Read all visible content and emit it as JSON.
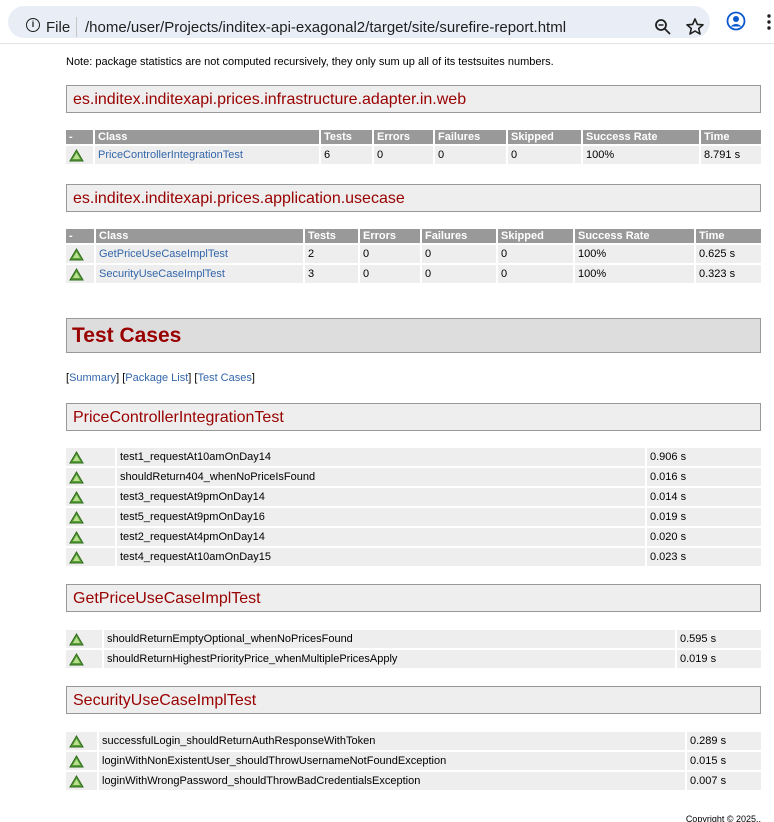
{
  "browser": {
    "scheme_label": "File",
    "url": "/home/user/Projects/inditex-api-exagonal2/target/site/surefire-report.html"
  },
  "note": "Note: package statistics are not computed recursively, they only sum up all of its testsuites numbers.",
  "packages": [
    {
      "name": "es.inditex.inditexapi.prices.infrastructure.adapter.in.web",
      "headers": [
        "-",
        "Class",
        "Tests",
        "Errors",
        "Failures",
        "Skipped",
        "Success Rate",
        "Time"
      ],
      "rows": [
        {
          "class": "PriceControllerIntegrationTest",
          "tests": "6",
          "errors": "0",
          "failures": "0",
          "skipped": "0",
          "success_rate": "100%",
          "time": "8.791 s"
        }
      ]
    },
    {
      "name": "es.inditex.inditexapi.prices.application.usecase",
      "headers": [
        "-",
        "Class",
        "Tests",
        "Errors",
        "Failures",
        "Skipped",
        "Success Rate",
        "Time"
      ],
      "rows": [
        {
          "class": "GetPriceUseCaseImplTest",
          "tests": "2",
          "errors": "0",
          "failures": "0",
          "skipped": "0",
          "success_rate": "100%",
          "time": "0.625 s"
        },
        {
          "class": "SecurityUseCaseImplTest",
          "tests": "3",
          "errors": "0",
          "failures": "0",
          "skipped": "0",
          "success_rate": "100%",
          "time": "0.323 s"
        }
      ]
    }
  ],
  "test_cases_title": "Test Cases",
  "nav": {
    "summary": "Summary",
    "package_list": "Package List",
    "test_cases": "Test Cases"
  },
  "suites": [
    {
      "name": "PriceControllerIntegrationTest",
      "cases": [
        {
          "name": "test1_requestAt10amOnDay14",
          "time": "0.906 s"
        },
        {
          "name": "shouldReturn404_whenNoPriceIsFound",
          "time": "0.016 s"
        },
        {
          "name": "test3_requestAt9pmOnDay14",
          "time": "0.014 s"
        },
        {
          "name": "test5_requestAt9pmOnDay16",
          "time": "0.019 s"
        },
        {
          "name": "test2_requestAt4pmOnDay14",
          "time": "0.020 s"
        },
        {
          "name": "test4_requestAt10amOnDay15",
          "time": "0.023 s"
        }
      ]
    },
    {
      "name": "GetPriceUseCaseImplTest",
      "cases": [
        {
          "name": "shouldReturnEmptyOptional_whenNoPricesFound",
          "time": "0.595 s"
        },
        {
          "name": "shouldReturnHighestPriorityPrice_whenMultiplePricesApply",
          "time": "0.019 s"
        }
      ]
    },
    {
      "name": "SecurityUseCaseImplTest",
      "cases": [
        {
          "name": "successfulLogin_shouldReturnAuthResponseWithToken",
          "time": "0.289 s"
        },
        {
          "name": "loginWithNonExistentUser_shouldThrowUsernameNotFoundException",
          "time": "0.015 s"
        },
        {
          "name": "loginWithWrongPassword_shouldThrowBadCredentialsException",
          "time": "0.007 s"
        }
      ]
    }
  ],
  "copyright": "Copyright © 2025.."
}
